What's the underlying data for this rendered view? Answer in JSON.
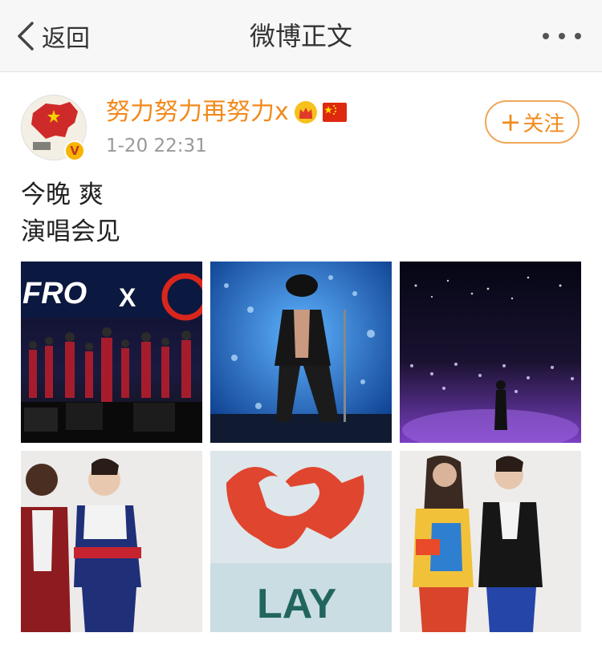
{
  "navbar": {
    "back_label": "返回",
    "title": "微博正文"
  },
  "post": {
    "username": "努力努力再努力x",
    "timestamp": "1-20 22:31",
    "follow_label": "关注",
    "text_lines": [
      "今晚 爽",
      "演唱会见"
    ]
  },
  "colors": {
    "accent": "#f18a1c",
    "follow_border": "#f0a659",
    "timestamp": "#999999"
  },
  "photos": [
    {
      "name": "concert-stage-dancers"
    },
    {
      "name": "performer-blue-lights"
    },
    {
      "name": "crowd-purple-lights"
    },
    {
      "name": "two-men-red-jackets"
    },
    {
      "name": "lay-logo-sign"
    },
    {
      "name": "two-men-colorful-jackets"
    }
  ]
}
